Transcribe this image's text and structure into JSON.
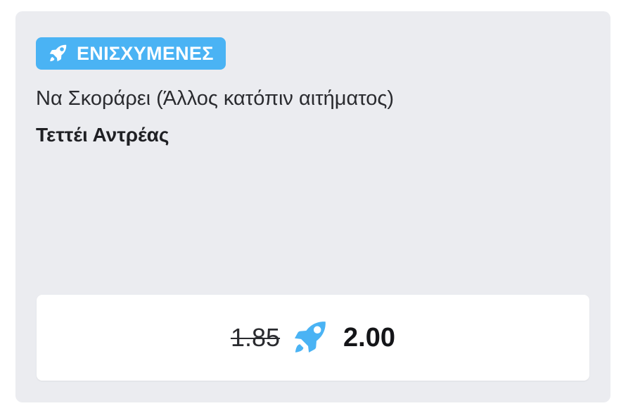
{
  "badge": {
    "label": "ΕΝΙΣΧΥΜΕΝΕΣ",
    "icon": "rocket-icon",
    "color": "#4ab3f4"
  },
  "market": {
    "name": "Να Σκοράρει (Άλλος κατόπιν αιτήματος)",
    "selection": "Τεττέι Αντρέας"
  },
  "odds": {
    "original": "1.85",
    "boosted": "2.00",
    "icon": "rocket-icon",
    "accent": "#4ab3f4"
  },
  "colors": {
    "card_background": "#ebecf0",
    "button_background": "#ffffff"
  }
}
